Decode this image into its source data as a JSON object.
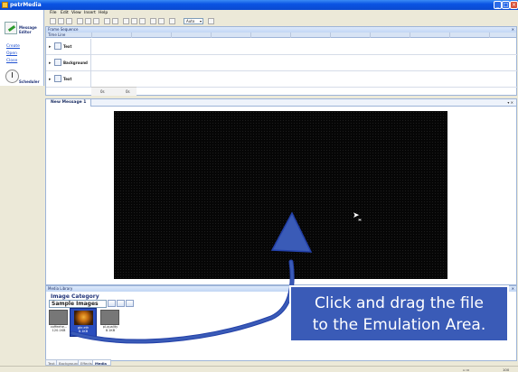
{
  "window": {
    "title": "petrMedia"
  },
  "nav": {
    "editor_label": "Message Editor",
    "links": [
      "Create",
      "Open",
      "Close"
    ],
    "scheduler_label": "Scheduler"
  },
  "menu": [
    "File",
    "Edit",
    "View",
    "Insert",
    "Help"
  ],
  "toolbar": {
    "zoom": "Auto"
  },
  "frame_sequence": {
    "title": "Frame Sequence",
    "timeline_label": "Time Line",
    "layers": [
      "Text",
      "Background",
      "Text"
    ],
    "durations": [
      "0s",
      "0s"
    ]
  },
  "emulation": {
    "tab_label": "New Message 1"
  },
  "media_library": {
    "title": "Media Library",
    "category_title": "Image Category",
    "category_value": "Sample Images",
    "thumbnails": [
      {
        "caption": "coffeehe...\n120.1KB"
      },
      {
        "caption": "gkr-eth\n8.1KB",
        "selected": true
      },
      {
        "caption": "pl-quality\n8.1KB"
      }
    ],
    "bottom_tabs": [
      "Text",
      "Background",
      "Effects",
      "Media Library"
    ]
  },
  "status": {
    "left": "",
    "zoom": "100"
  },
  "callout": {
    "line1": "Click and drag the file",
    "line2": "to the Emulation Area."
  }
}
